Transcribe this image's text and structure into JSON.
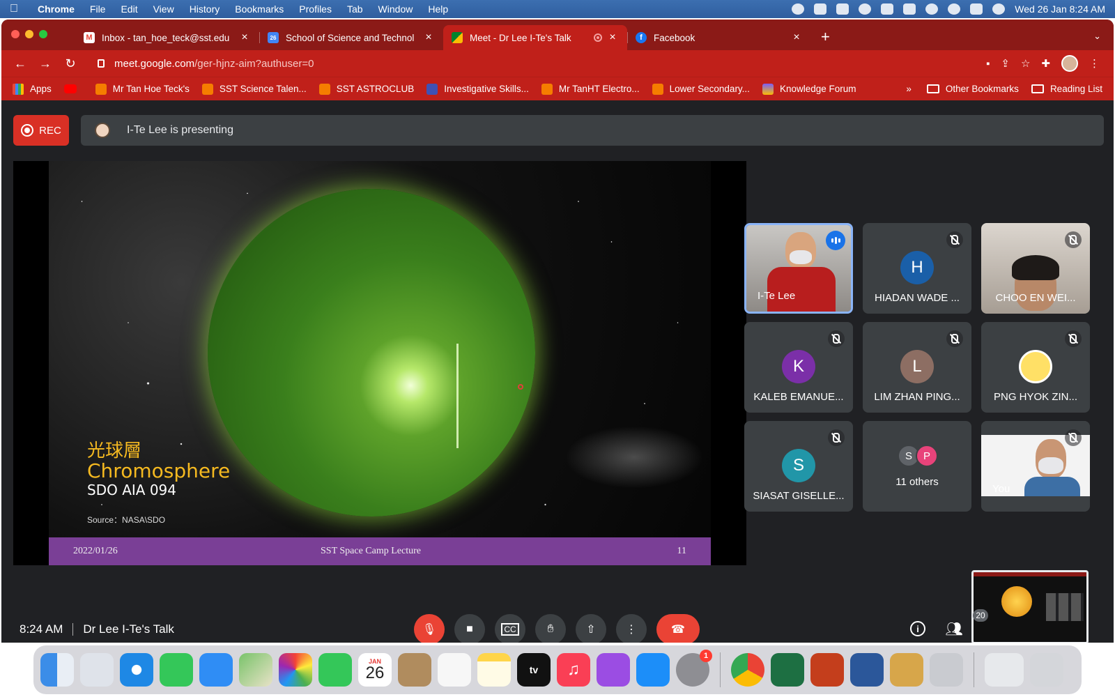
{
  "menubar": {
    "apple": "",
    "app_name": "Chrome",
    "items": [
      "File",
      "Edit",
      "View",
      "History",
      "Bookmarks",
      "Profiles",
      "Tab",
      "Window",
      "Help"
    ],
    "clock": "Wed 26 Jan  8:24 AM"
  },
  "tabs": [
    {
      "title": "Inbox - tan_hoe_teck@sst.edu",
      "icon": "gmail-icon",
      "color": "#ea4335"
    },
    {
      "title": "School of Science and Technol",
      "icon": "calendar-icon",
      "color": "#4285f4"
    },
    {
      "title": "Meet - Dr Lee I-Te's Talk",
      "icon": "meet-icon",
      "color": "#00832d"
    },
    {
      "title": "Facebook",
      "icon": "facebook-icon",
      "color": "#1877f2"
    }
  ],
  "omnibox": {
    "host": "meet.google.com",
    "path": "/ger-hjnz-aim?authuser=0"
  },
  "bookmarks": {
    "items": [
      {
        "label": "Apps",
        "icon": "apps-grid-icon"
      },
      {
        "label": "",
        "icon": "youtube-icon"
      },
      {
        "label": "Mr Tan Hoe Teck's",
        "icon": "blogger-icon"
      },
      {
        "label": "SST Science Talen...",
        "icon": "blogger-icon"
      },
      {
        "label": "SST ASTROCLUB",
        "icon": "blogger-icon"
      },
      {
        "label": "Investigative Skills...",
        "icon": "site-icon"
      },
      {
        "label": "Mr TanHT Electro...",
        "icon": "blogger-icon"
      },
      {
        "label": "Lower Secondary...",
        "icon": "blogger-icon"
      },
      {
        "label": "Knowledge Forum",
        "icon": "knowledge-forum-icon"
      }
    ],
    "more": "»",
    "other": "Other Bookmarks",
    "reading_list": "Reading List"
  },
  "meet": {
    "rec_label": "REC",
    "presenting_text": "I-Te Lee is presenting",
    "meeting_time": "8:24 AM",
    "meeting_title": "Dr Lee I-Te's Talk",
    "people_count": "20"
  },
  "slide": {
    "title_zh": "光球層",
    "title_en": "Chromosphere",
    "subtitle": "SDO AIA 094",
    "source": "Source：NASA\\SDO",
    "footer_date": "2022/01/26",
    "footer_title": "SST Space Camp Lecture",
    "footer_page": "11"
  },
  "participants": [
    {
      "name": "I-Te Lee",
      "type": "video",
      "speaking": true
    },
    {
      "name": "HIADAN WADE ...",
      "type": "avatar",
      "initial": "H",
      "color": "#1a5fa8"
    },
    {
      "name": "CHOO EN WEI...",
      "type": "video"
    },
    {
      "name": "KALEB EMANUE...",
      "type": "avatar",
      "initial": "K",
      "color": "#7b2fa8"
    },
    {
      "name": "LIM ZHAN PING...",
      "type": "avatar",
      "initial": "L",
      "color": "#8d6e63"
    },
    {
      "name": "PNG HYOK ZIN...",
      "type": "image"
    },
    {
      "name": "SIASAT GISELLE...",
      "type": "avatar",
      "initial": "S",
      "color": "#2196a8"
    },
    {
      "name": "11 others",
      "type": "others",
      "initials": [
        "S",
        "P"
      ],
      "colors": [
        "#5f6368",
        "#e8437a"
      ]
    },
    {
      "name": "You",
      "type": "self"
    }
  ],
  "controls": [
    "mic-off-icon",
    "camera-icon",
    "captions-icon",
    "raise-hand-icon",
    "present-icon",
    "more-options-icon",
    "end-call-icon"
  ],
  "dock": {
    "calendar_month": "JAN",
    "calendar_day": "26",
    "settings_badge": "1",
    "tv_label": "tv"
  }
}
